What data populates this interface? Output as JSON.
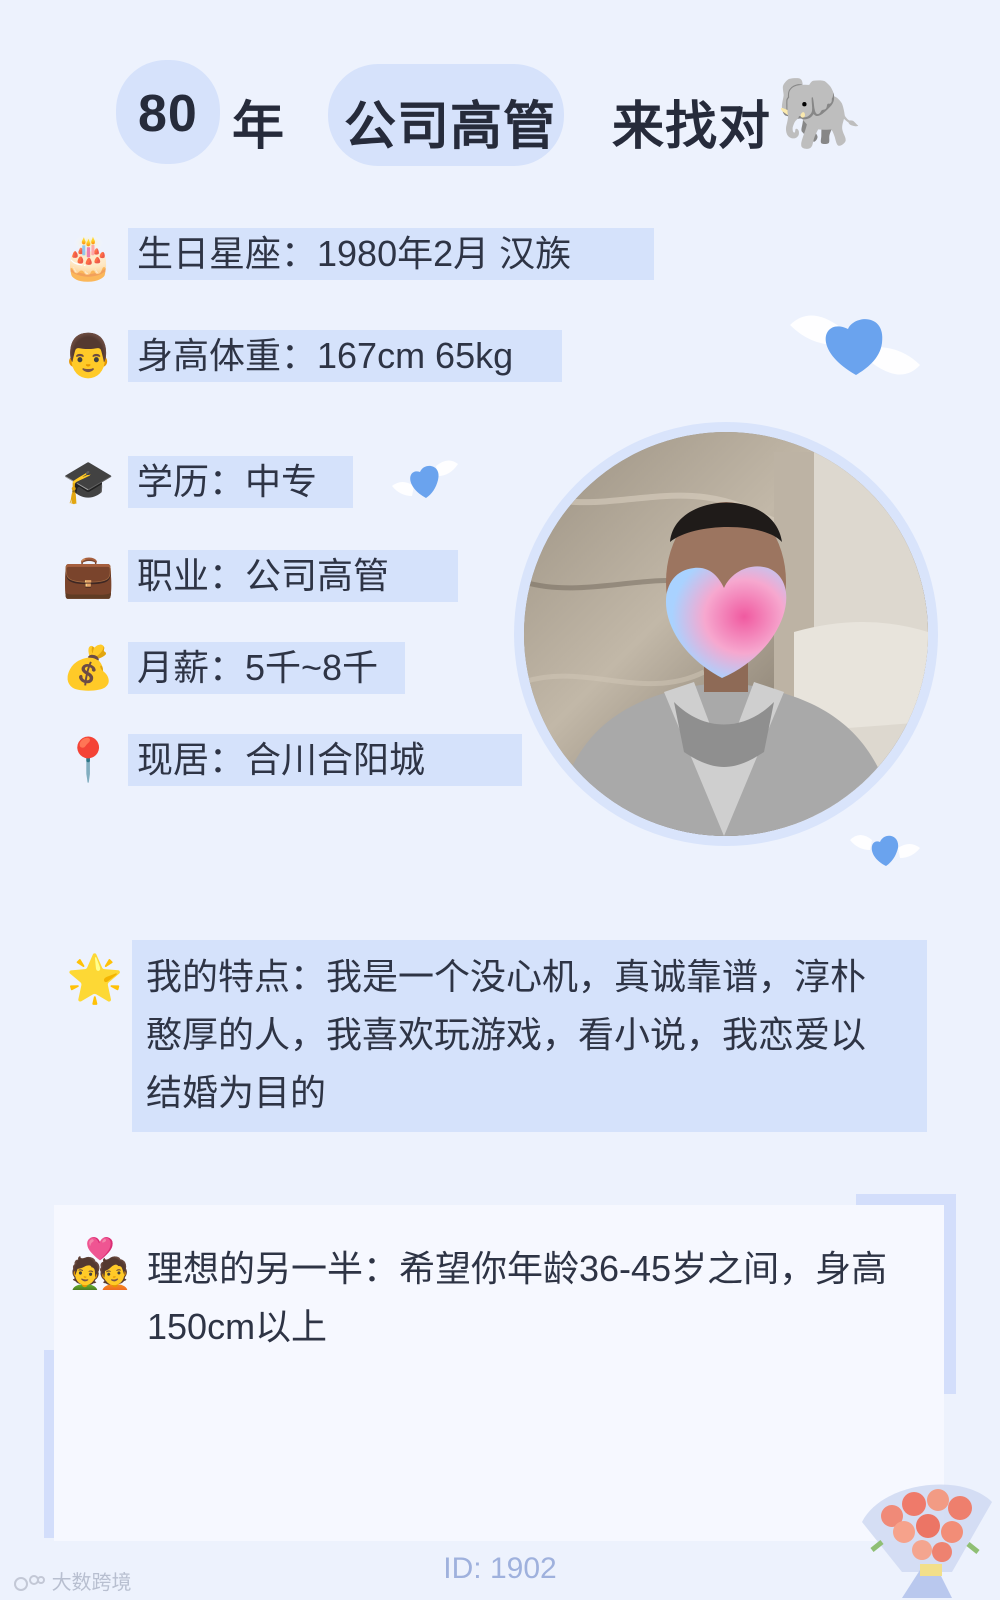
{
  "header": {
    "age": "80",
    "year_suffix": "年",
    "job": "公司高管",
    "seeking": "来找对",
    "seeking_emoji": "🐘"
  },
  "info_rows": [
    {
      "icon": "birthday-cake-icon",
      "emoji": "🎂",
      "text": "生日星座：1980年2月 汉族"
    },
    {
      "icon": "man-face-icon",
      "emoji": "👨",
      "text": "身高体重：167cm 65kg"
    },
    {
      "icon": "graduation-cap-icon",
      "emoji": "🎓",
      "text": "学历：中专"
    },
    {
      "icon": "briefcase-icon",
      "emoji": "💼",
      "text": "职业：公司高管"
    },
    {
      "icon": "money-bag-icon",
      "emoji": "💰",
      "text": "月薪：5千~8千"
    },
    {
      "icon": "location-pin-icon",
      "emoji": "📍",
      "text": "现居：合川合阳城"
    }
  ],
  "feature": {
    "emoji": "🌟",
    "lines": [
      "我的特点：我是一个没心机，真诚靠谱，淳朴",
      "憨厚的人，我喜欢玩游戏，看小说，我恋爱以",
      "结婚为目的"
    ]
  },
  "ideal": {
    "emoji": "💑",
    "lines": [
      "理想的另一半：希望你年龄36-45岁之间，身高",
      "150cm以上"
    ]
  },
  "footer": {
    "id_text": "ID: 1902",
    "watermark": "大数跨境"
  },
  "colors": {
    "background": "#edf2fd",
    "highlight": "#d5e2fb",
    "heart": "#6aa3ee",
    "id_text": "#9fb1dd"
  }
}
